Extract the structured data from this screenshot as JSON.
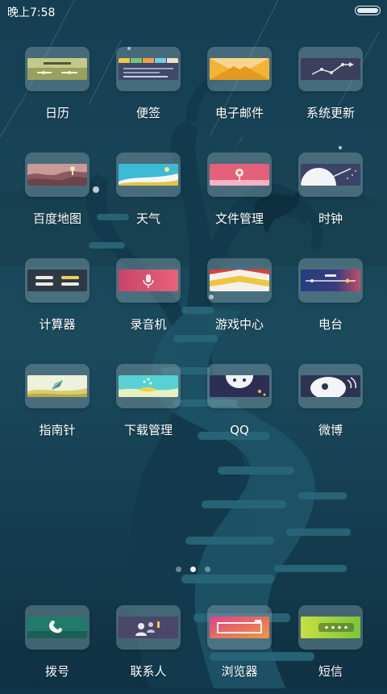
{
  "status_bar": {
    "time": "晚上7:58",
    "battery_icon": "battery-full-icon"
  },
  "colors": {
    "background": "#10344a",
    "label": "#ffffff",
    "tile": "rgba(150,175,185,0.38)"
  },
  "apps": [
    {
      "label": "日历",
      "icon": "calendar-icon"
    },
    {
      "label": "便签",
      "icon": "notes-icon"
    },
    {
      "label": "电子邮件",
      "icon": "email-icon"
    },
    {
      "label": "系统更新",
      "icon": "system-update-icon"
    },
    {
      "label": "百度地图",
      "icon": "baidu-map-icon"
    },
    {
      "label": "天气",
      "icon": "weather-icon"
    },
    {
      "label": "文件管理",
      "icon": "file-manager-icon"
    },
    {
      "label": "时钟",
      "icon": "clock-icon"
    },
    {
      "label": "计算器",
      "icon": "calculator-icon"
    },
    {
      "label": "录音机",
      "icon": "recorder-icon"
    },
    {
      "label": "游戏中心",
      "icon": "game-center-icon"
    },
    {
      "label": "电台",
      "icon": "radio-icon"
    },
    {
      "label": "指南针",
      "icon": "compass-icon"
    },
    {
      "label": "下载管理",
      "icon": "download-manager-icon"
    },
    {
      "label": "QQ",
      "icon": "qq-icon"
    },
    {
      "label": "微博",
      "icon": "weibo-icon"
    }
  ],
  "dock": [
    {
      "label": "拨号",
      "icon": "phone-icon"
    },
    {
      "label": "联系人",
      "icon": "contacts-icon"
    },
    {
      "label": "浏览器",
      "icon": "browser-icon"
    },
    {
      "label": "短信",
      "icon": "sms-icon"
    }
  ],
  "pager": {
    "page_count": 3,
    "current_page": 2
  }
}
